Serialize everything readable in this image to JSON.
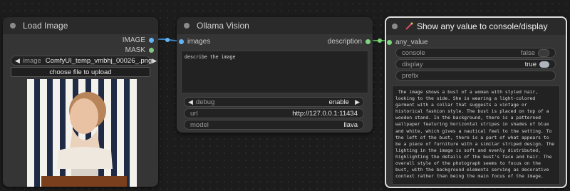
{
  "load_image": {
    "title": "Load Image",
    "outputs": {
      "image": "IMAGE",
      "mask": "MASK"
    },
    "image_widget": {
      "label": "image",
      "value": "ComfyUI_temp_vmbhj_00026_.png"
    },
    "upload_button": "choose file to upload"
  },
  "ollama_vision": {
    "title": "Ollama Vision",
    "input_label": "images",
    "output_label": "description",
    "prompt": "describe the image",
    "debug": {
      "label": "debug",
      "value": "enable"
    },
    "url": {
      "label": "url",
      "value": "http://127.0.0.1:11434"
    },
    "model": {
      "label": "model",
      "value": "llava"
    }
  },
  "show_any": {
    "title": "Show any value to console/display",
    "input_label": "any_value",
    "console": {
      "label": "console",
      "value": "false"
    },
    "display": {
      "label": "display",
      "value": "true"
    },
    "prefix": {
      "label": "prefix"
    },
    "output_text": " The image shows a bust of a woman with styled hair, looking to the side. She is wearing a light-colored garment with a collar that suggests a vintage or historical fashion style. The bust is placed on top of a wooden stand. In the background, there is a patterned wallpaper featuring horizontal stripes in shades of blue and white, which gives a nautical feel to the setting. To the left of the bust, there is a part of what appears to be a piece of furniture with a similar striped design. The lighting in the image is soft and evenly distributed, highlighting the details of the bust's face and hair. The overall style of the photograph seems to focus on the bust, with the background elements serving as decorative context rather than being the main focus of the image."
  },
  "colors": {
    "image_port": "#64b5f6",
    "mask_port": "#81c784",
    "string_port": "#7ed67e",
    "link": "#3d86c6",
    "selected_border": "#e0e0e0"
  }
}
